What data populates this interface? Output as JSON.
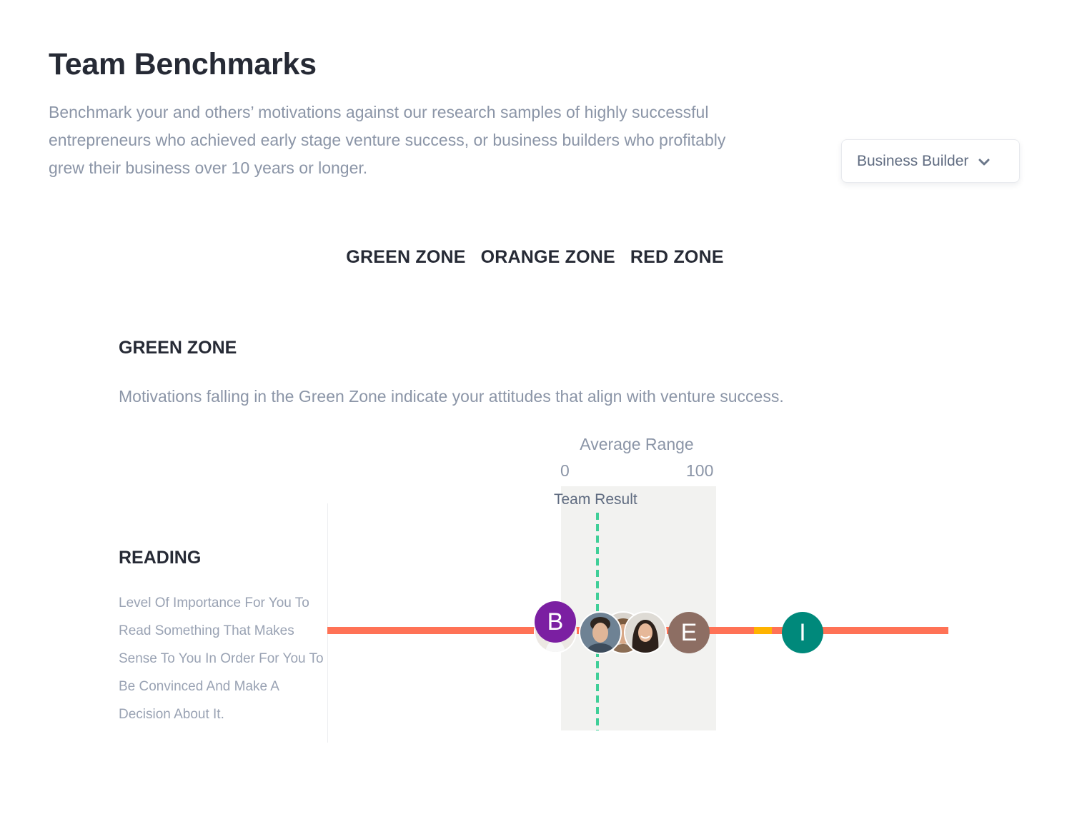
{
  "header": {
    "title": "Team Benchmarks",
    "description": "Benchmark your and others’ motivations against our research samples of highly successful entrepreneurs who achieved early stage venture success, or business builders who profitably grew their business over 10 years or longer."
  },
  "benchmark_select": {
    "selected": "Business Builder",
    "icon": "chevron-down-icon"
  },
  "zone_tabs": [
    {
      "label": "GREEN ZONE"
    },
    {
      "label": "ORANGE ZONE"
    },
    {
      "label": "RED ZONE"
    }
  ],
  "section": {
    "title": "GREEN ZONE",
    "description": "Motivations falling in the Green Zone indicate your attitudes that align with venture success."
  },
  "metric": {
    "title": "READING",
    "description": "Level Of Importance For You To Read Something That Makes Sense To You In Order For You To Be Convinced And Make A Decision About It."
  },
  "average_range": {
    "title": "Average Range",
    "min_label": "0",
    "max_label": "100"
  },
  "team_result": {
    "label": "Team Result"
  },
  "colors": {
    "track": "#ff7256",
    "track_highlight": "#ffb300",
    "team_result_line": "#3fcf98",
    "average_band": "#f2f2f0"
  },
  "members": [
    {
      "type": "photo",
      "name": "member-photo-woman-under-b",
      "bg": "#e9e4df"
    },
    {
      "type": "letter",
      "initial": "B",
      "color": "#7b1fa2"
    },
    {
      "type": "photo",
      "name": "member-photo-curly-man",
      "bg": "#c9b6a4"
    },
    {
      "type": "photo",
      "name": "member-photo-man",
      "bg": "#7d8c9a"
    },
    {
      "type": "photo",
      "name": "member-photo-woman",
      "bg": "#d9d6d0"
    },
    {
      "type": "letter",
      "initial": "E",
      "color": "#8d6e63"
    },
    {
      "type": "letter",
      "initial": "I",
      "color": "#00897b"
    }
  ]
}
